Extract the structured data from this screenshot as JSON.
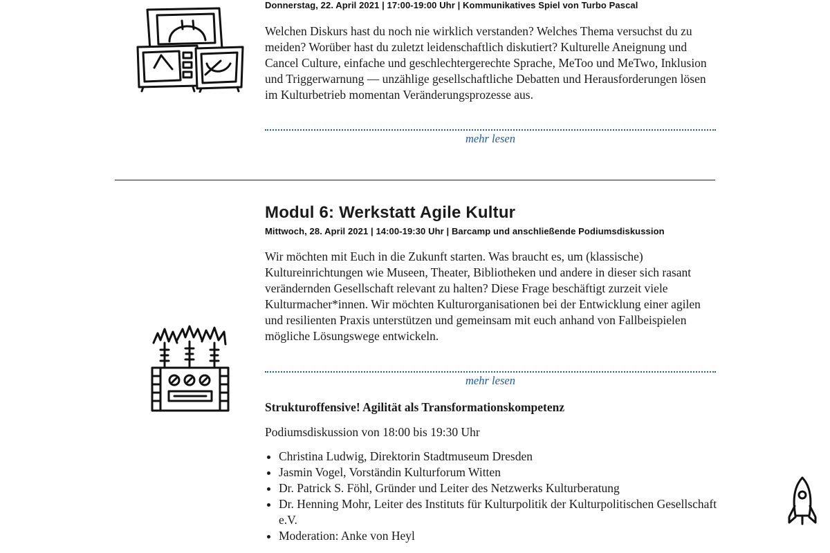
{
  "module5": {
    "meta": "Donnerstag, 22. April 2021 | 17:00-19:00 Uhr | Kommunikatives Spiel von Turbo Pascal",
    "description": "Welchen Diskurs hast du noch nie wirklich verstanden? Welches Thema versuchst du zu meiden? Worüber hast du zuletzt leidenschaftlich diskutiert? Kulturelle Aneignung und Cancel Culture, einfache und geschlechtergerechte Sprache, MeToo und MeTwo, Inklusion und Triggerwarnung — unzählige gesellschaftliche Debatten und Herausforderungen lösen im Kulturbetrieb momentan Veränderungsprozesse aus.",
    "more_label": "mehr lesen",
    "illustration_icon": "retro-tv-stack-icon"
  },
  "module6": {
    "title": "Modul 6: Werkstatt Agile Kultur",
    "meta": "Mittwoch, 28. April 2021 | 14:00-19:30 Uhr | Barcamp und anschließende Podiumsdiskussion",
    "description": "Wir möchten mit Euch in die Zukunft starten. Was braucht es, um (klassische) Kultureinrichtungen wie Museen, Theater, Bibliotheken und andere in dieser sich rasant verändernden Gesellschaft relevant zu halten? Diese Frage beschäftigt zurzeit viele Kulturmacher*innen. Wir möchten Kulturorganisationen bei der Entwicklung einer agilen und resilienten Praxis unterstützen und gemeinsam mit euch anhand von Fallbeispielen mögliche Lösungswege entwickeln.",
    "more_label": "mehr lesen",
    "panel_title": "Strukturoffensive! Agilität als Transformationskompetenz",
    "panel_time": "Podiumsdiskussion von 18:00 bis 19:30 Uhr",
    "speakers": [
      "Christina Ludwig, Direktorin Stadtmuseum Dresden",
      "Jasmin Vogel, Vorständin Kulturforum Witten",
      "Dr. Patrick S. Föhl, Gründer und Leiter des Netzwerks Kulturberatung",
      "Dr. Henning Mohr, Leiter des Instituts für Kulturpolitik der Kulturpolitischen Gesellschaft e.V.",
      "Moderation: Anke von Heyl"
    ],
    "illustration_icon": "transformer-sparks-icon"
  },
  "scroll_top_icon": "rocket-icon",
  "colors": {
    "link": "#1f5b9c",
    "text": "#1a1a1a",
    "divider": "#222222"
  }
}
